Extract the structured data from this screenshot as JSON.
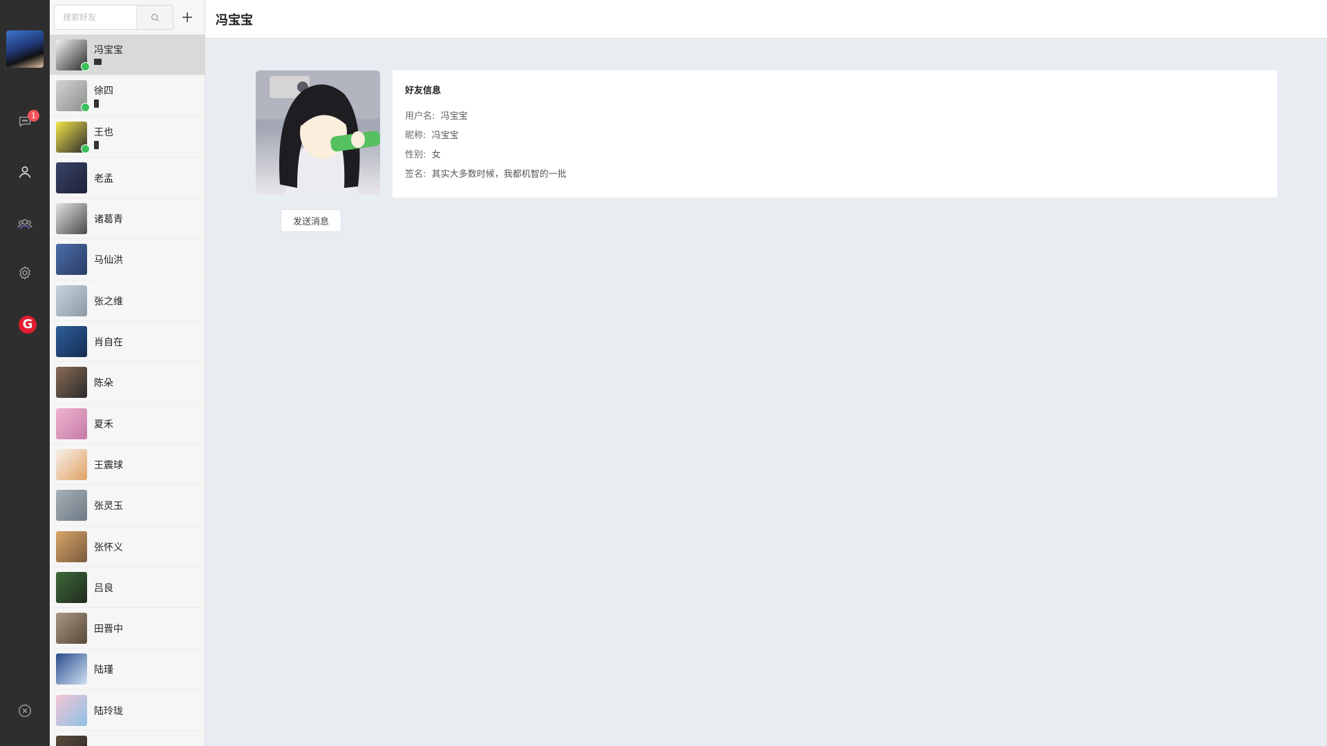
{
  "rail": {
    "unread_count": "1"
  },
  "search": {
    "placeholder": "搜索好友"
  },
  "friends": [
    {
      "name": "冯宝宝",
      "online": true,
      "device": "desktop",
      "active": true,
      "color1": "#f3f3f3",
      "color2": "#2a2a2a"
    },
    {
      "name": "徐四",
      "online": true,
      "device": "phone",
      "color1": "#d7d3d6",
      "color2": "#8a8f8a"
    },
    {
      "name": "王也",
      "online": true,
      "device": "phone",
      "color1": "#f2e64a",
      "color2": "#2b2b2b"
    },
    {
      "name": "老孟",
      "color1": "#3a4466",
      "color2": "#1c2238"
    },
    {
      "name": "诸葛青",
      "color1": "#e3e3e3",
      "color2": "#4a4a4a"
    },
    {
      "name": "马仙洪",
      "color1": "#4b6ea8",
      "color2": "#2b3c66"
    },
    {
      "name": "张之维",
      "color1": "#c8d4dd",
      "color2": "#8c9aa6"
    },
    {
      "name": "肖自在",
      "color1": "#2c5f9a",
      "color2": "#162c52"
    },
    {
      "name": "陈朵",
      "color1": "#8a6a55",
      "color2": "#2b2b2b"
    },
    {
      "name": "夏禾",
      "color1": "#f0b4d0",
      "color2": "#c47aa6"
    },
    {
      "name": "王震球",
      "color1": "#f7f2ea",
      "color2": "#e0a064"
    },
    {
      "name": "张灵玉",
      "color1": "#a8b0b8",
      "color2": "#6d7a84"
    },
    {
      "name": "张怀义",
      "color1": "#d8a668",
      "color2": "#7a5a3c"
    },
    {
      "name": "吕良",
      "color1": "#3f6a3a",
      "color2": "#1f2a1f"
    },
    {
      "name": "田晋中",
      "color1": "#a89682",
      "color2": "#5a4a3a"
    },
    {
      "name": "陆瑾",
      "color1": "#2b4d8c",
      "color2": "#cfe0f2"
    },
    {
      "name": "陆玲珑",
      "color1": "#f4c4d4",
      "color2": "#8cc2e6"
    },
    {
      "name": "",
      "color1": "#5a4a3a",
      "color2": "#2a2a2a"
    }
  ],
  "header": {
    "title": "冯宝宝"
  },
  "profile": {
    "section_title": "好友信息",
    "fields": [
      {
        "label": "用户名:",
        "value": "冯宝宝"
      },
      {
        "label": "昵称:",
        "value": "冯宝宝"
      },
      {
        "label": "性别:",
        "value": "女"
      },
      {
        "label": "签名:",
        "value": "其实大多数时候，我都机智的一批"
      }
    ],
    "send_label": "发送消息"
  },
  "colors": {
    "rail_bg": "#2e2e2e",
    "panel_bg": "#f6f6f6",
    "main_bg": "#e8edf2",
    "online_dot": "#3ac15a",
    "badge": "#f0545a",
    "g_logo": "#e01e2e"
  }
}
